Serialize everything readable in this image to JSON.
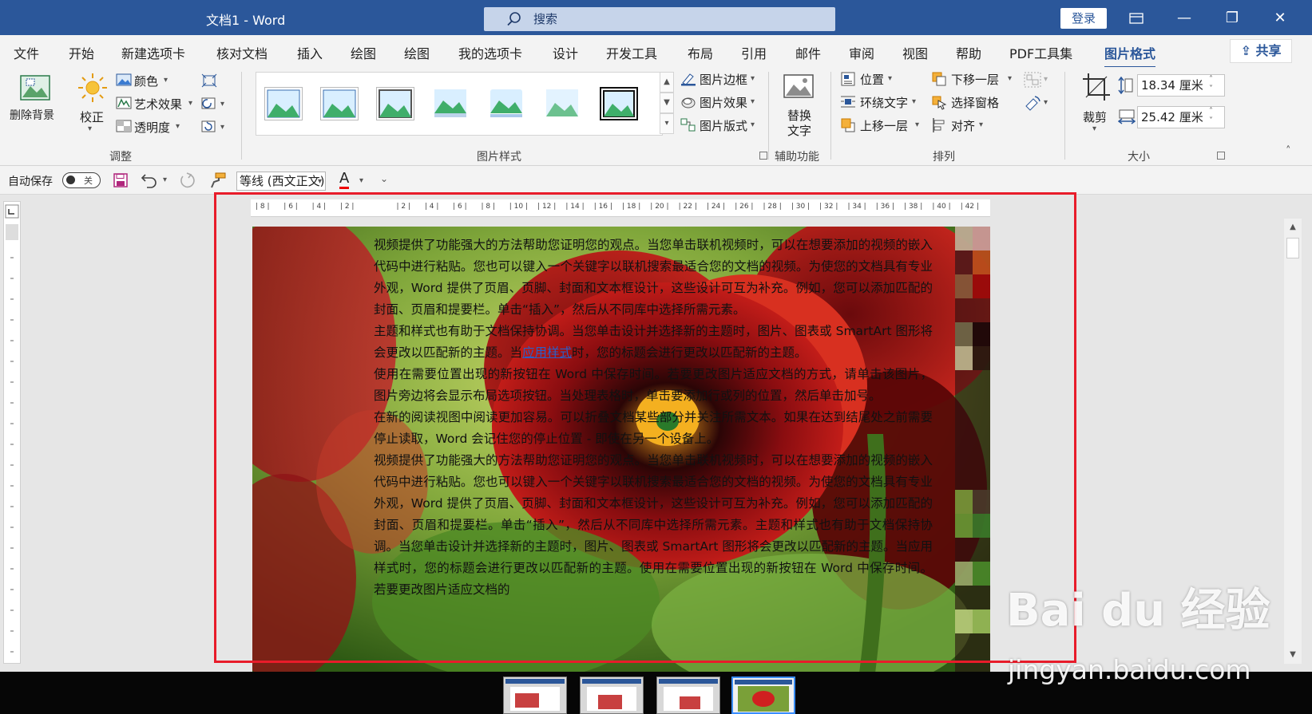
{
  "titlebar": {
    "title": "文档1  -  Word",
    "search_placeholder": "搜索",
    "login": "登录",
    "minimize": "—",
    "restore": "❐",
    "close": "✕"
  },
  "tabs": [
    {
      "label": "文件"
    },
    {
      "label": "开始"
    },
    {
      "label": "新建选项卡"
    },
    {
      "label": "核对文档"
    },
    {
      "label": "插入"
    },
    {
      "label": "绘图"
    },
    {
      "label": "绘图"
    },
    {
      "label": "我的选项卡"
    },
    {
      "label": "设计"
    },
    {
      "label": "开发工具"
    },
    {
      "label": "布局"
    },
    {
      "label": "引用"
    },
    {
      "label": "邮件"
    },
    {
      "label": "审阅"
    },
    {
      "label": "视图"
    },
    {
      "label": "帮助"
    },
    {
      "label": "PDF工具集"
    },
    {
      "label": "图片格式"
    }
  ],
  "share": "共享",
  "ribbon": {
    "adjust": {
      "remove_bg": "删除背景",
      "correct": "校正",
      "color": "颜色",
      "artistic": "艺术效果",
      "transparency": "透明度",
      "group": "调整"
    },
    "styles": {
      "border": "图片边框",
      "effects": "图片效果",
      "layout": "图片版式",
      "group": "图片样式"
    },
    "accessibility": {
      "alt_text_1": "替换",
      "alt_text_2": "文字",
      "group": "辅助功能"
    },
    "arrange": {
      "position": "位置",
      "wrap": "环绕文字",
      "forward": "上移一层",
      "backward": "下移一层",
      "pane": "选择窗格",
      "align": "对齐",
      "group": "排列"
    },
    "size": {
      "crop": "裁剪",
      "height": "18.34 厘米",
      "width": "25.42 厘米",
      "group": "大小"
    }
  },
  "qat": {
    "autosave": "自动保存",
    "toggle_state": "关",
    "font": "等线 (西文正文)",
    "font_color_letter": "A"
  },
  "document": {
    "paragraphs": [
      "视频提供了功能强大的方法帮助您证明您的观点。当您单击联机视频时，可以在想要添加的视频的嵌入代码中进行粘贴。您也可以键入一个关键字以联机搜索最适合您的文档的视频。为使您的文档具有专业外观，Word 提供了页眉、页脚、封面和文本框设计，这些设计可互为补充。例如，您可以添加匹配的封面、页眉和提要栏。单击“插入”，然后从不同库中选择所需元素。",
      "主题和样式也有助于文档保持协调。当您单击设计并选择新的主题时，图片、图表或 SmartArt 图形将会更改以匹配新的主题。当",
      "应用样式",
      "时，您的标题会进行更改以匹配新的主题。",
      "使用在需要位置出现的新按钮在 Word 中保存时间。若要更改图片适应文档的方式，请单击该图片，图片旁边将会显示布局选项按钮。当处理表格时，单击要添加行或列的位置，然后单击加号。",
      "在新的阅读视图中阅读更加容易。可以折叠文档某些部分并关注所需文本。如果在达到结尾处之前需要停止读取，Word 会记住您的停止位置 - 即使在另一个设备上。",
      "视频提供了功能强大的方法帮助您证明您的观点。当您单击联机视频时，可以在想要添加的视频的嵌入代码中进行粘贴。您也可以键入一个关键字以联机搜索最适合您的文档的视频。为使您的文档具有专业外观，Word 提供了页眉、页脚、封面和文本框设计，这些设计可互为补充。例如，您可以添加匹配的封面、页眉和提要栏。单击“插入”，然后从不同库中选择所需元素。主题和样式也有助于文档保持协调。当您单击设计并选择新的主题时，图片、图表或 SmartArt 图形将会更改以匹配新的主题。当应用样式时，您的标题会进行更改以匹配新的主题。使用在需要位置出现的新按钮在 Word 中保存时间。若要更改图片适应文档的"
    ]
  },
  "ruler_labels": [
    "8",
    "6",
    "4",
    "2",
    "",
    "2",
    "4",
    "6",
    "8",
    "10",
    "12",
    "14",
    "16",
    "18",
    "20",
    "22",
    "24",
    "26",
    "28",
    "30",
    "32",
    "34",
    "36",
    "38",
    "40",
    "42"
  ],
  "watermark": {
    "brand": "Bai du 经验",
    "url": "jingyan.baidu.com"
  },
  "colors": {
    "accent": "#2b579a",
    "highlight_frame": "#e81c2a",
    "link": "#2b5fc7"
  }
}
